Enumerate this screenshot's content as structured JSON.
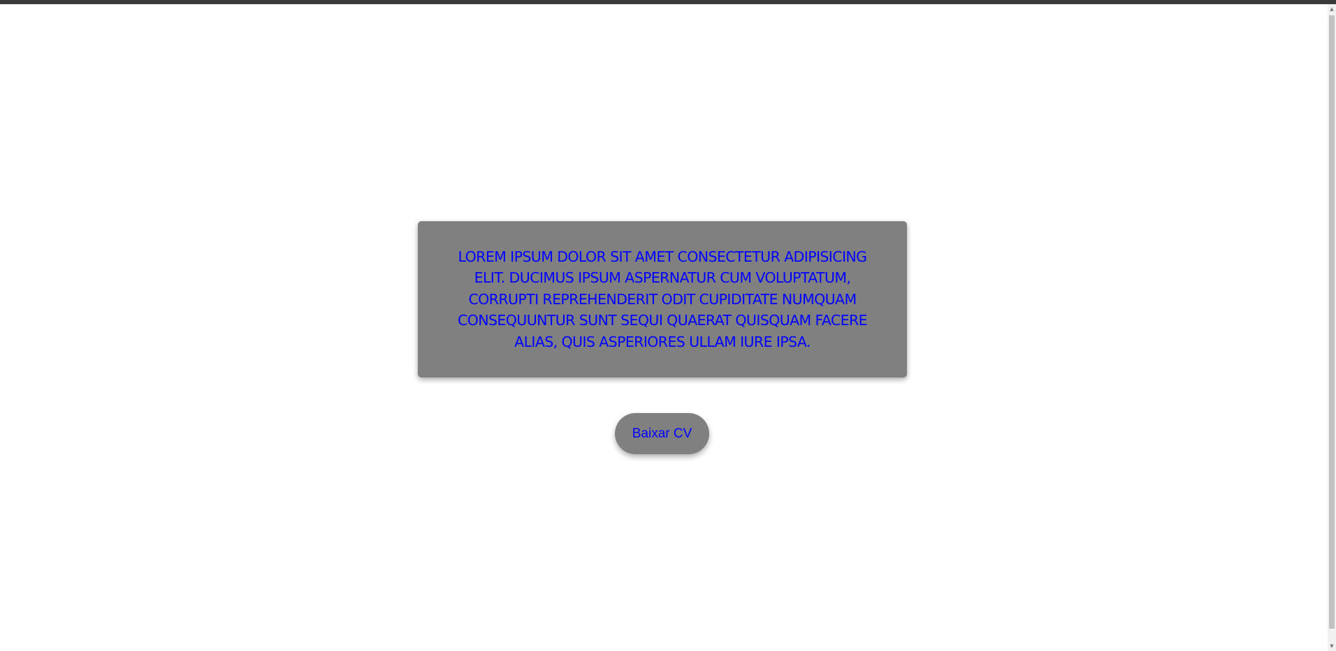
{
  "card": {
    "text": "Lorem ipsum dolor sit amet consectetur adipisicing elit. Ducimus ipsum aspernatur cum voluptatum, corrupti reprehenderit odit cupiditate numquam consequuntur sunt sequi quaerat quisquam facere alias, quis asperiores ullam iure ipsa."
  },
  "button": {
    "label": "Baixar CV"
  },
  "colors": {
    "text": "#0000ff",
    "card_background": "#808080",
    "button_background": "#808080",
    "page_background": "#ffffff"
  },
  "icons": {
    "scroll_up": "chevron-up-icon",
    "scroll_down": "chevron-down-icon"
  }
}
